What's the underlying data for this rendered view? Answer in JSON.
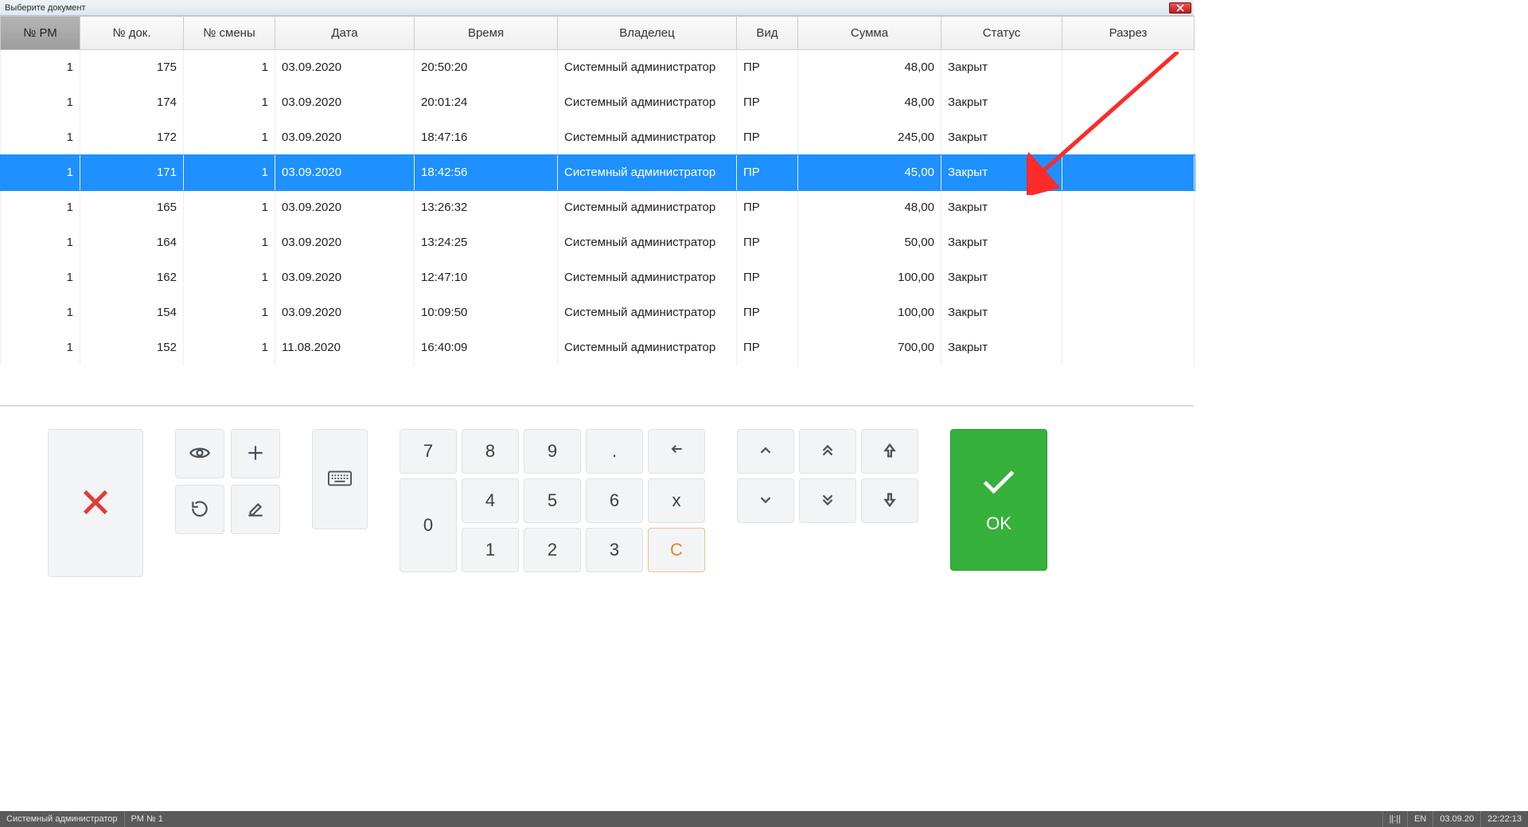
{
  "window": {
    "title": "Выберите документ"
  },
  "columns": [
    "№ РМ",
    "№ док.",
    "№ смены",
    "Дата",
    "Время",
    "Владелец",
    "Вид",
    "Сумма",
    "Статус",
    "Разрез"
  ],
  "selected_index": 3,
  "rows": [
    {
      "pm": "1",
      "doc": "175",
      "shift": "1",
      "date": "03.09.2020",
      "time": "20:50:20",
      "owner": "Системный администратор",
      "type": "ПР",
      "sum": "48,00",
      "status": "Закрыт",
      "slice": ""
    },
    {
      "pm": "1",
      "doc": "174",
      "shift": "1",
      "date": "03.09.2020",
      "time": "20:01:24",
      "owner": "Системный администратор",
      "type": "ПР",
      "sum": "48,00",
      "status": "Закрыт",
      "slice": ""
    },
    {
      "pm": "1",
      "doc": "172",
      "shift": "1",
      "date": "03.09.2020",
      "time": "18:47:16",
      "owner": "Системный администратор",
      "type": "ПР",
      "sum": "245,00",
      "status": "Закрыт",
      "slice": ""
    },
    {
      "pm": "1",
      "doc": "171",
      "shift": "1",
      "date": "03.09.2020",
      "time": "18:42:56",
      "owner": "Системный администратор",
      "type": "ПР",
      "sum": "45,00",
      "status": "Закрыт",
      "slice": ""
    },
    {
      "pm": "1",
      "doc": "165",
      "shift": "1",
      "date": "03.09.2020",
      "time": "13:26:32",
      "owner": "Системный администратор",
      "type": "ПР",
      "sum": "48,00",
      "status": "Закрыт",
      "slice": ""
    },
    {
      "pm": "1",
      "doc": "164",
      "shift": "1",
      "date": "03.09.2020",
      "time": "13:24:25",
      "owner": "Системный администратор",
      "type": "ПР",
      "sum": "50,00",
      "status": "Закрыт",
      "slice": ""
    },
    {
      "pm": "1",
      "doc": "162",
      "shift": "1",
      "date": "03.09.2020",
      "time": "12:47:10",
      "owner": "Системный администратор",
      "type": "ПР",
      "sum": "100,00",
      "status": "Закрыт",
      "slice": ""
    },
    {
      "pm": "1",
      "doc": "154",
      "shift": "1",
      "date": "03.09.2020",
      "time": "10:09:50",
      "owner": "Системный администратор",
      "type": "ПР",
      "sum": "100,00",
      "status": "Закрыт",
      "slice": ""
    },
    {
      "pm": "1",
      "doc": "152",
      "shift": "1",
      "date": "11.08.2020",
      "time": "16:40:09",
      "owner": "Системный администратор",
      "type": "ПР",
      "sum": "700,00",
      "status": "Закрыт",
      "slice": ""
    }
  ],
  "keypad": {
    "d7": "7",
    "d8": "8",
    "d9": "9",
    "dot": ".",
    "d4": "4",
    "d5": "5",
    "d6": "6",
    "d1": "1",
    "d2": "2",
    "d3": "3",
    "d0": "0",
    "mult": "x",
    "clear": "C"
  },
  "ok": {
    "label": "OK"
  },
  "status": {
    "user": "Системный администратор",
    "workstation": "РМ № 1",
    "lang_indicator": "||:||",
    "lang": "EN",
    "date": "03.09.20",
    "time": "22:22:13"
  }
}
